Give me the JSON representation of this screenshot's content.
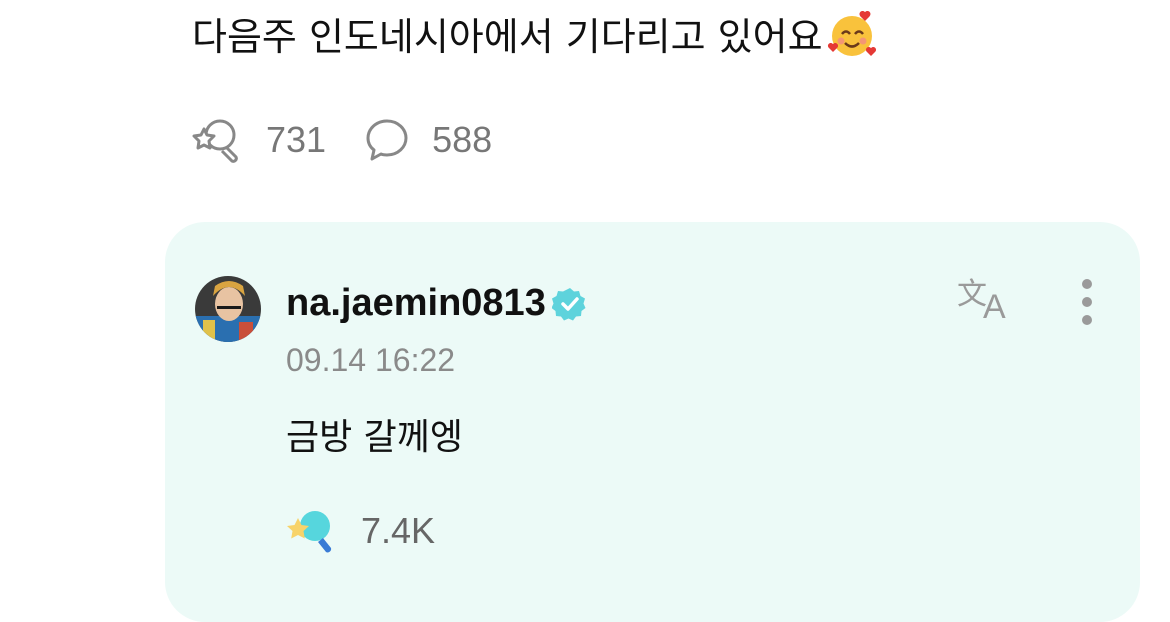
{
  "post": {
    "text": "다음주 인도네시아에서 기다리고 있어요",
    "emoji": "smiling-face-with-hearts"
  },
  "stats": {
    "reactions": "731",
    "comments": "588"
  },
  "comment": {
    "username": "na.jaemin0813",
    "timestamp": "09.14 16:22",
    "text": "금방 갈께엥",
    "likes": "7.4K"
  },
  "colors": {
    "card_bg": "#ecfaf7",
    "verified": "#5ed3dc",
    "icon_gray": "#8a8a8a"
  }
}
